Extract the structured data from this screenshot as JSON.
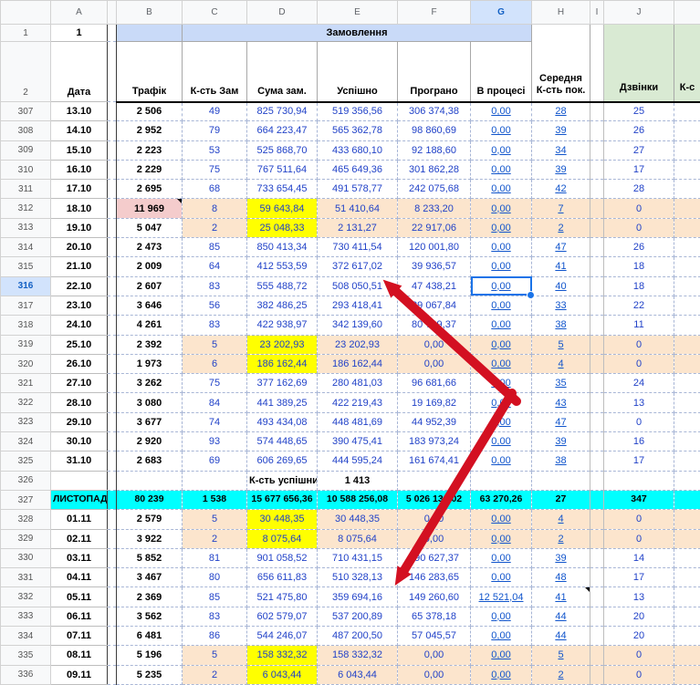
{
  "header": {
    "letters": [
      "A",
      "",
      "B",
      "C",
      "D",
      "E",
      "F",
      "G",
      "H",
      "I",
      "J",
      ""
    ],
    "selected_letter": "G"
  },
  "gutter": {
    "r1": "1",
    "r2": "2"
  },
  "top": {
    "a1": "1",
    "orders_band": "Замовлення",
    "col_headers": {
      "a": "Дата",
      "b": "Трафік",
      "c": "К-сть Зам",
      "d": "Сума зам.",
      "e": "Успішно",
      "f": "Програно",
      "g": "В процесі",
      "h": "Середня К-сть пок.",
      "j": "Дзвінки",
      "k": "К-с"
    }
  },
  "note_row": {
    "label": "К-сть успішних",
    "value": "1 413"
  },
  "selected_cell": {
    "row": "316",
    "col": "G",
    "value": "0,00"
  },
  "colors": {
    "yellow_highlight": "#ffff00",
    "cyan_month_row": "#00ffff",
    "pink_traffic": "#f4cccc",
    "orange_row": "#fce5cd",
    "header_blue": "#c9daf8",
    "header_green": "#d9ead3",
    "selection_blue": "#1a73e8",
    "arrow_red": "#d31021",
    "link_blue": "#1155cc"
  },
  "rows": [
    {
      "n": "307",
      "date": "13.10",
      "traffic": "2 506",
      "orders": "49",
      "sum": "825 730,94",
      "ok": "519 356,56",
      "lost": "306 374,38",
      "proc": "0,00",
      "avg": "28",
      "calls": "25",
      "style": "w"
    },
    {
      "n": "308",
      "date": "14.10",
      "traffic": "2 952",
      "orders": "79",
      "sum": "664 223,47",
      "ok": "565 362,78",
      "lost": "98 860,69",
      "proc": "0,00",
      "avg": "39",
      "calls": "26",
      "style": "w"
    },
    {
      "n": "309",
      "date": "15.10",
      "traffic": "2 223",
      "orders": "53",
      "sum": "525 868,70",
      "ok": "433 680,10",
      "lost": "92 188,60",
      "proc": "0,00",
      "avg": "34",
      "calls": "27",
      "style": "w"
    },
    {
      "n": "310",
      "date": "16.10",
      "traffic": "2 229",
      "orders": "75",
      "sum": "767 511,64",
      "ok": "465 649,36",
      "lost": "301 862,28",
      "proc": "0,00",
      "avg": "39",
      "calls": "17",
      "style": "w"
    },
    {
      "n": "311",
      "date": "17.10",
      "traffic": "2 695",
      "orders": "68",
      "sum": "733 654,45",
      "ok": "491 578,77",
      "lost": "242 075,68",
      "proc": "0,00",
      "avg": "42",
      "calls": "28",
      "style": "w"
    },
    {
      "n": "312",
      "date": "18.10",
      "traffic": "11 969",
      "orders": "8",
      "sum": "59 643,84",
      "ok": "51 410,64",
      "lost": "8 233,20",
      "proc": "0,00",
      "avg": "7",
      "calls": "0",
      "style": "o",
      "pink": true,
      "markB": true
    },
    {
      "n": "313",
      "date": "19.10",
      "traffic": "5 047",
      "orders": "2",
      "sum": "25 048,33",
      "ok": "2 131,27",
      "lost": "22 917,06",
      "proc": "0,00",
      "avg": "2",
      "calls": "0",
      "style": "o"
    },
    {
      "n": "314",
      "date": "20.10",
      "traffic": "2 473",
      "orders": "85",
      "sum": "850 413,34",
      "ok": "730 411,54",
      "lost": "120 001,80",
      "proc": "0,00",
      "avg": "47",
      "calls": "26",
      "style": "w"
    },
    {
      "n": "315",
      "date": "21.10",
      "traffic": "2 009",
      "orders": "64",
      "sum": "412 553,59",
      "ok": "372 617,02",
      "lost": "39 936,57",
      "proc": "0,00",
      "avg": "41",
      "calls": "18",
      "style": "w"
    },
    {
      "n": "316",
      "date": "22.10",
      "traffic": "2 607",
      "orders": "83",
      "sum": "555 488,72",
      "ok": "508 050,51",
      "lost": "47 438,21",
      "proc": "0,00",
      "avg": "40",
      "calls": "18",
      "style": "w",
      "sel": true
    },
    {
      "n": "317",
      "date": "23.10",
      "traffic": "3 646",
      "orders": "56",
      "sum": "382 486,25",
      "ok": "293 418,41",
      "lost": "89 067,84",
      "proc": "0,00",
      "avg": "33",
      "calls": "22",
      "style": "w"
    },
    {
      "n": "318",
      "date": "24.10",
      "traffic": "4 261",
      "orders": "83",
      "sum": "422 938,97",
      "ok": "342 139,60",
      "lost": "80 799,37",
      "proc": "0,00",
      "avg": "38",
      "calls": "11",
      "style": "w"
    },
    {
      "n": "319",
      "date": "25.10",
      "traffic": "2 392",
      "orders": "5",
      "sum": "23 202,93",
      "ok": "23 202,93",
      "lost": "0,00",
      "proc": "0,00",
      "avg": "5",
      "calls": "0",
      "style": "o"
    },
    {
      "n": "320",
      "date": "26.10",
      "traffic": "1 973",
      "orders": "6",
      "sum": "186 162,44",
      "ok": "186 162,44",
      "lost": "0,00",
      "proc": "0,00",
      "avg": "4",
      "calls": "0",
      "style": "o"
    },
    {
      "n": "321",
      "date": "27.10",
      "traffic": "3 262",
      "orders": "75",
      "sum": "377 162,69",
      "ok": "280 481,03",
      "lost": "96 681,66",
      "proc": "0,00",
      "avg": "35",
      "calls": "24",
      "style": "w"
    },
    {
      "n": "322",
      "date": "28.10",
      "traffic": "3 080",
      "orders": "84",
      "sum": "441 389,25",
      "ok": "422 219,43",
      "lost": "19 169,82",
      "proc": "0,00",
      "avg": "43",
      "calls": "13",
      "style": "w"
    },
    {
      "n": "323",
      "date": "29.10",
      "traffic": "3 677",
      "orders": "74",
      "sum": "493 434,08",
      "ok": "448 481,69",
      "lost": "44 952,39",
      "proc": "0,00",
      "avg": "47",
      "calls": "0",
      "style": "w"
    },
    {
      "n": "324",
      "date": "30.10",
      "traffic": "2 920",
      "orders": "93",
      "sum": "574 448,65",
      "ok": "390 475,41",
      "lost": "183 973,24",
      "proc": "0,00",
      "avg": "39",
      "calls": "16",
      "style": "w"
    },
    {
      "n": "325",
      "date": "31.10",
      "traffic": "2 683",
      "orders": "69",
      "sum": "606 269,65",
      "ok": "444 595,24",
      "lost": "161 674,41",
      "proc": "0,00",
      "avg": "38",
      "calls": "17",
      "style": "w"
    },
    {
      "n": "326",
      "type": "note",
      "style": "w"
    },
    {
      "n": "327",
      "date": "ЛИСТОПАД.",
      "traffic": "80 239",
      "orders": "1 538",
      "sum": "15 677 656,36",
      "ok": "10 588 256,08",
      "lost": "5 026 130,02",
      "proc": "63 270,26",
      "avg": "27",
      "calls": "347",
      "style": "m"
    },
    {
      "n": "328",
      "date": "01.11",
      "traffic": "2 579",
      "orders": "5",
      "sum": "30 448,35",
      "ok": "30 448,35",
      "lost": "0,00",
      "proc": "0,00",
      "avg": "4",
      "calls": "0",
      "style": "o"
    },
    {
      "n": "329",
      "date": "02.11",
      "traffic": "3 922",
      "orders": "2",
      "sum": "8 075,64",
      "ok": "8 075,64",
      "lost": "0,00",
      "proc": "0,00",
      "avg": "2",
      "calls": "0",
      "style": "o"
    },
    {
      "n": "330",
      "date": "03.11",
      "traffic": "5 852",
      "orders": "81",
      "sum": "901 058,52",
      "ok": "710 431,15",
      "lost": "190 627,37",
      "proc": "0,00",
      "avg": "39",
      "calls": "14",
      "style": "w"
    },
    {
      "n": "331",
      "date": "04.11",
      "traffic": "3 467",
      "orders": "80",
      "sum": "656 611,83",
      "ok": "510 328,13",
      "lost": "146 283,65",
      "proc": "0,00",
      "avg": "48",
      "calls": "17",
      "style": "w"
    },
    {
      "n": "332",
      "date": "05.11",
      "traffic": "2 369",
      "orders": "85",
      "sum": "521 475,80",
      "ok": "359 694,16",
      "lost": "149 260,60",
      "proc": "12 521,04",
      "avg": "41",
      "calls": "13",
      "style": "w",
      "markH": true
    },
    {
      "n": "333",
      "date": "06.11",
      "traffic": "3 562",
      "orders": "83",
      "sum": "602 579,07",
      "ok": "537 200,89",
      "lost": "65 378,18",
      "proc": "0,00",
      "avg": "44",
      "calls": "20",
      "style": "w"
    },
    {
      "n": "334",
      "date": "07.11",
      "traffic": "6 481",
      "orders": "86",
      "sum": "544 246,07",
      "ok": "487 200,50",
      "lost": "57 045,57",
      "proc": "0,00",
      "avg": "44",
      "calls": "20",
      "style": "w"
    },
    {
      "n": "335",
      "date": "08.11",
      "traffic": "5 196",
      "orders": "5",
      "sum": "158 332,32",
      "ok": "158 332,32",
      "lost": "0,00",
      "proc": "0,00",
      "avg": "5",
      "calls": "0",
      "style": "o"
    },
    {
      "n": "336",
      "date": "09.11",
      "traffic": "5 235",
      "orders": "2",
      "sum": "6 043,44",
      "ok": "6 043,44",
      "lost": "0,00",
      "proc": "0,00",
      "avg": "2",
      "calls": "0",
      "style": "o"
    }
  ]
}
